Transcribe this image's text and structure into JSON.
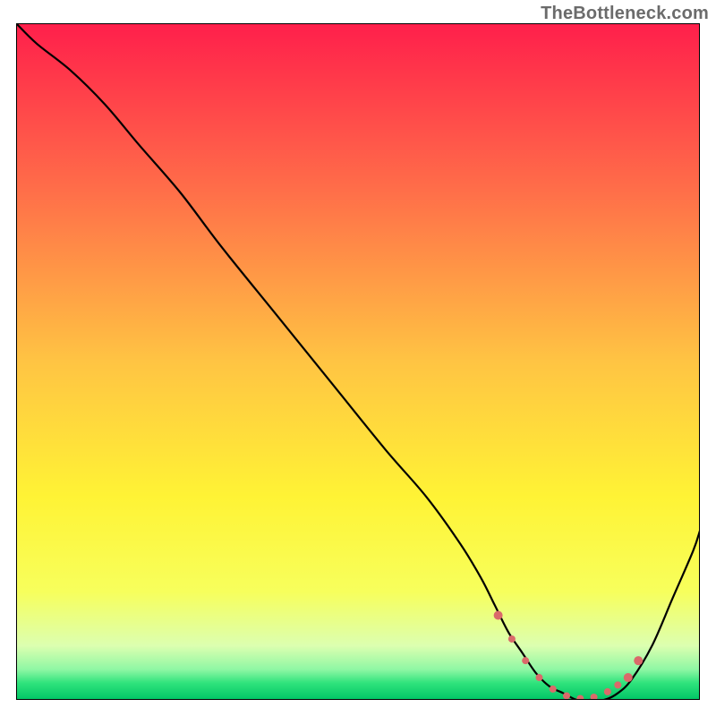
{
  "watermark": "TheBottleneck.com",
  "chart_data": {
    "type": "line",
    "title": "",
    "xlabel": "",
    "ylabel": "",
    "xlim": [
      0,
      100
    ],
    "ylim": [
      0,
      100
    ],
    "grid": false,
    "legend": false,
    "gradient_stops": [
      {
        "offset": 0.0,
        "color": "#ff1f4b"
      },
      {
        "offset": 0.25,
        "color": "#ff6f49"
      },
      {
        "offset": 0.5,
        "color": "#ffc443"
      },
      {
        "offset": 0.7,
        "color": "#fff335"
      },
      {
        "offset": 0.84,
        "color": "#f7ff5c"
      },
      {
        "offset": 0.92,
        "color": "#dcffb0"
      },
      {
        "offset": 0.955,
        "color": "#8ff7a4"
      },
      {
        "offset": 0.975,
        "color": "#2fe37c"
      },
      {
        "offset": 1.0,
        "color": "#00c566"
      }
    ],
    "series": [
      {
        "name": "bottleneck-curve",
        "color": "#000000",
        "x": [
          0,
          3,
          8,
          13,
          18,
          24,
          30,
          38,
          46,
          54,
          60,
          65,
          68,
          70,
          72,
          74,
          76,
          78,
          80,
          82,
          84,
          86,
          88,
          90,
          93,
          96,
          99,
          100
        ],
        "y": [
          100,
          97,
          93,
          88,
          82,
          75,
          67,
          57,
          47,
          37,
          30,
          23,
          18,
          14,
          10,
          7,
          4,
          2,
          1,
          0,
          0,
          0,
          1,
          3,
          8,
          15,
          22,
          25
        ]
      }
    ],
    "markers": {
      "name": "optimal-range",
      "color": "#da6a6a",
      "radius_small": 4,
      "radius_large": 5,
      "points": [
        {
          "x": 70.5,
          "y": 12.5,
          "r": "large"
        },
        {
          "x": 72.5,
          "y": 9.0,
          "r": "small"
        },
        {
          "x": 74.5,
          "y": 5.8,
          "r": "small"
        },
        {
          "x": 76.5,
          "y": 3.3,
          "r": "small"
        },
        {
          "x": 78.5,
          "y": 1.6,
          "r": "small"
        },
        {
          "x": 80.5,
          "y": 0.6,
          "r": "small"
        },
        {
          "x": 82.5,
          "y": 0.2,
          "r": "small"
        },
        {
          "x": 84.5,
          "y": 0.4,
          "r": "small"
        },
        {
          "x": 86.5,
          "y": 1.2,
          "r": "small"
        },
        {
          "x": 88.0,
          "y": 2.2,
          "r": "small"
        },
        {
          "x": 89.5,
          "y": 3.3,
          "r": "large"
        },
        {
          "x": 91.0,
          "y": 5.8,
          "r": "large"
        }
      ]
    }
  }
}
